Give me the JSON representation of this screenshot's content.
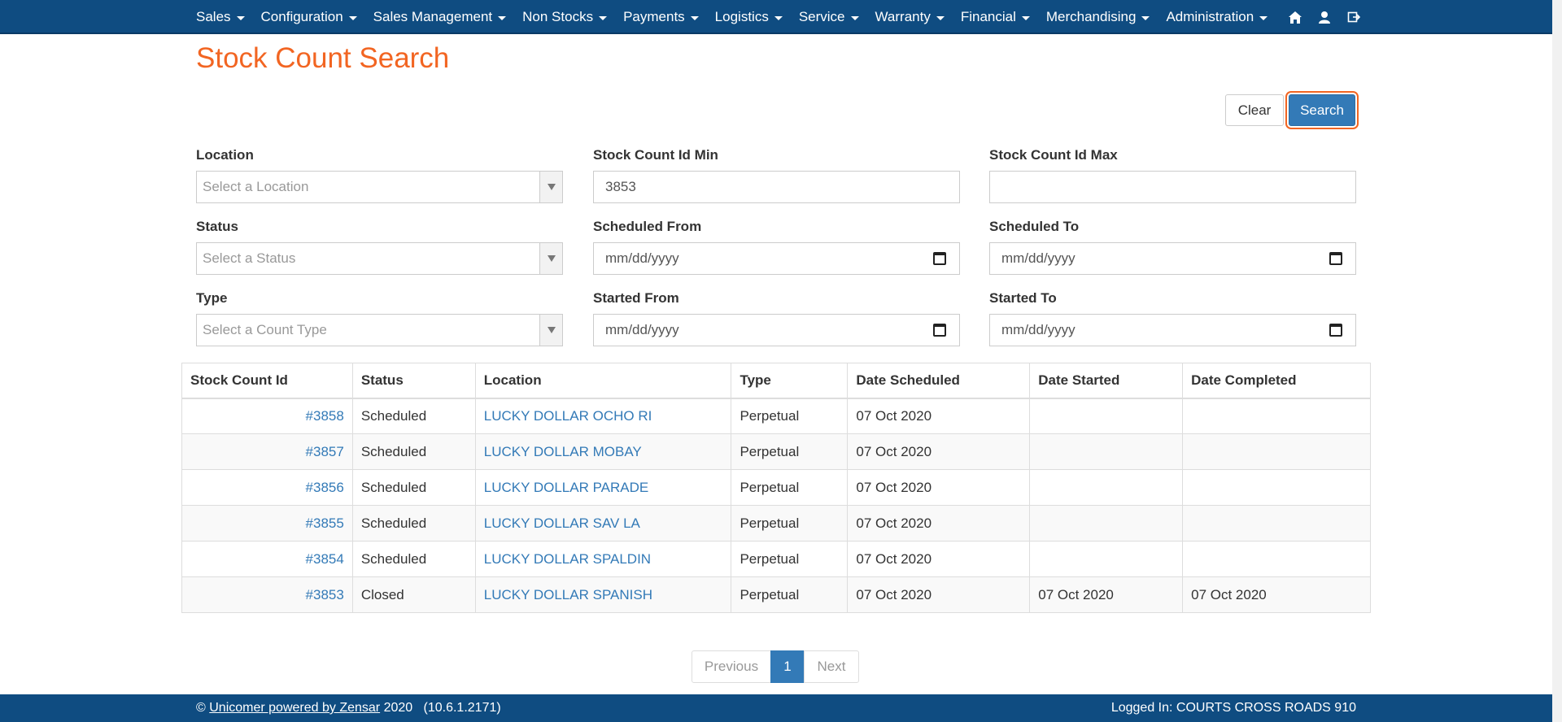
{
  "nav": {
    "items": [
      {
        "label": "Sales"
      },
      {
        "label": "Configuration"
      },
      {
        "label": "Sales Management"
      },
      {
        "label": "Non Stocks"
      },
      {
        "label": "Payments"
      },
      {
        "label": "Logistics"
      },
      {
        "label": "Service"
      },
      {
        "label": "Warranty"
      },
      {
        "label": "Financial"
      },
      {
        "label": "Merchandising"
      },
      {
        "label": "Administration"
      }
    ],
    "icons": [
      "home-icon",
      "user-icon",
      "logout-icon"
    ]
  },
  "page": {
    "title": "Stock Count Search"
  },
  "buttons": {
    "clear": "Clear",
    "search": "Search"
  },
  "filters": {
    "location": {
      "label": "Location",
      "placeholder": "Select a Location"
    },
    "id_min": {
      "label": "Stock Count Id Min",
      "value": "3853"
    },
    "id_max": {
      "label": "Stock Count Id Max",
      "value": ""
    },
    "status": {
      "label": "Status",
      "placeholder": "Select a Status"
    },
    "scheduled_from": {
      "label": "Scheduled From",
      "value": "mm/dd/yyyy"
    },
    "scheduled_to": {
      "label": "Scheduled To",
      "value": "mm/dd/yyyy"
    },
    "type": {
      "label": "Type",
      "placeholder": "Select a Count Type"
    },
    "started_from": {
      "label": "Started From",
      "value": "mm/dd/yyyy"
    },
    "started_to": {
      "label": "Started To",
      "value": "mm/dd/yyyy"
    }
  },
  "table": {
    "headers": [
      "Stock Count Id",
      "Status",
      "Location",
      "Type",
      "Date Scheduled",
      "Date Started",
      "Date Completed"
    ],
    "rows": [
      [
        "#3858",
        "Scheduled",
        "LUCKY DOLLAR OCHO RI",
        "Perpetual",
        "07 Oct 2020",
        "",
        ""
      ],
      [
        "#3857",
        "Scheduled",
        "LUCKY DOLLAR MOBAY",
        "Perpetual",
        "07 Oct 2020",
        "",
        ""
      ],
      [
        "#3856",
        "Scheduled",
        "LUCKY DOLLAR PARADE",
        "Perpetual",
        "07 Oct 2020",
        "",
        ""
      ],
      [
        "#3855",
        "Scheduled",
        "LUCKY DOLLAR SAV LA",
        "Perpetual",
        "07 Oct 2020",
        "",
        ""
      ],
      [
        "#3854",
        "Scheduled",
        "LUCKY DOLLAR SPALDIN",
        "Perpetual",
        "07 Oct 2020",
        "",
        ""
      ],
      [
        "#3853",
        "Closed",
        "LUCKY DOLLAR SPANISH",
        "Perpetual",
        "07 Oct 2020",
        "07 Oct 2020",
        "07 Oct 2020"
      ]
    ]
  },
  "pagination": {
    "previous": "Previous",
    "current": "1",
    "next": "Next"
  },
  "footer": {
    "copyright_symbol": "©",
    "company_link": "Unicomer powered by Zensar",
    "year_version": "2020   (10.6.1.2171)",
    "logged_in": "Logged In: COURTS CROSS ROADS 910"
  },
  "colors": {
    "nav_bg": "#0f4c81",
    "title": "#f26522",
    "primary": "#337ab7",
    "link": "#337ab7"
  }
}
